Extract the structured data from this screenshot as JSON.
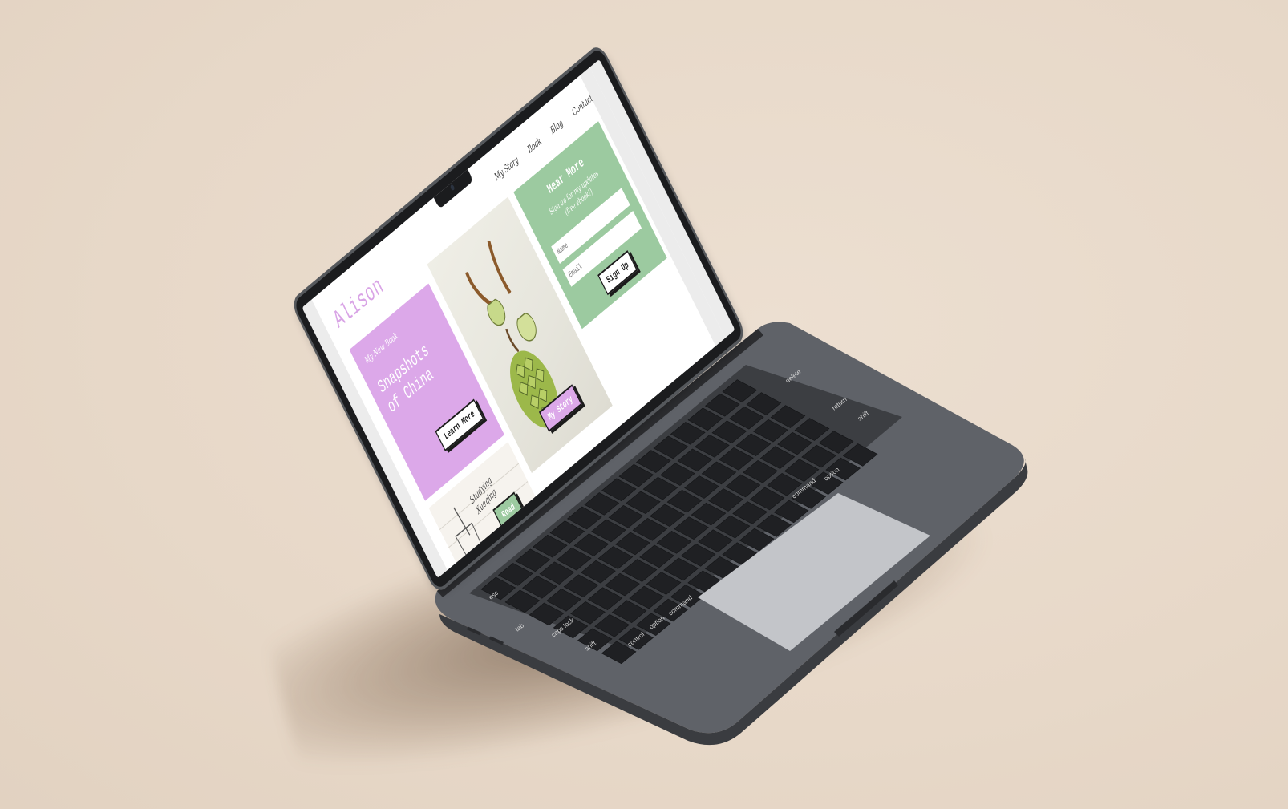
{
  "site": {
    "brand": "Alison",
    "nav": [
      "My Story",
      "Book",
      "Blog",
      "Contact"
    ]
  },
  "book_card": {
    "kicker": "My New Book",
    "title_line1": "Snapshots",
    "title_line2": "of China",
    "button": "Learn More"
  },
  "story_card": {
    "button": "My Story"
  },
  "signup_card": {
    "title": "Hear More",
    "subtitle_line1": "Sign up for my updates",
    "subtitle_line2": "(free ebook!)",
    "name_placeholder": "Name",
    "email_placeholder": "Email",
    "button": "Sign Up"
  },
  "blog_card": {
    "caption_line1": "Studying",
    "caption_line2": "Xueqing",
    "button": "Read"
  },
  "colors": {
    "purple": "#dca8e9",
    "green": "#9ccaa0",
    "backdrop": "#e9dbcc",
    "laptop": "#5c5f64"
  },
  "keyboard": {
    "labels": [
      "esc",
      "tab",
      "caps lock",
      "shift",
      "control",
      "option",
      "command",
      "delete",
      "return",
      "shift",
      "command",
      "option"
    ]
  }
}
